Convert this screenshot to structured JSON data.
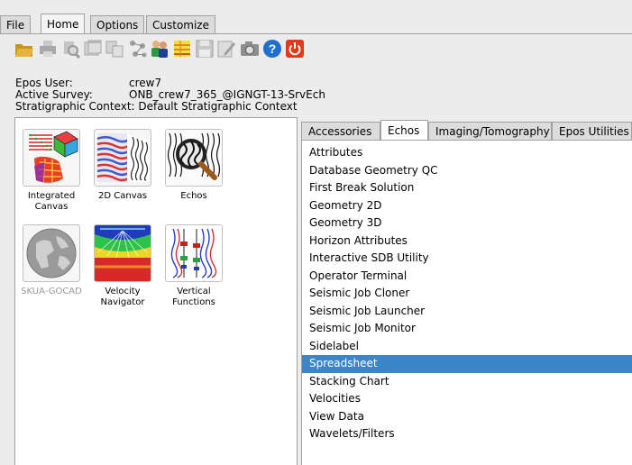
{
  "menu_tabs": [
    {
      "label": "File",
      "active": false
    },
    {
      "label": "Home",
      "active": true
    },
    {
      "label": "Options",
      "active": false
    },
    {
      "label": "Customize",
      "active": false
    }
  ],
  "toolbar_icons": [
    "open-folder-icon",
    "print-icon",
    "print-preview-icon",
    "window-icon",
    "copy-window-icon",
    "network-icon",
    "users-icon",
    "wall-icon",
    "save-icon",
    "edit-icon",
    "camera-icon",
    "help-icon",
    "power-icon"
  ],
  "info": {
    "user_label": "Epos User:",
    "user_value": "crew7",
    "survey_label": "Active Survey:",
    "survey_value": "ONB_crew7_365_@IGNGT-13-SrvEch",
    "context_label": "Stratigraphic Context:",
    "context_value": "Default Stratigraphic Context"
  },
  "apps": [
    {
      "label": "Integrated Canvas",
      "icon": "integrated-canvas-icon",
      "enabled": true
    },
    {
      "label": "2D Canvas",
      "icon": "2d-canvas-icon",
      "enabled": true
    },
    {
      "label": "Echos",
      "icon": "echos-icon",
      "enabled": true
    },
    {
      "label": "SKUA-GOCAD",
      "icon": "skua-gocad-icon",
      "enabled": false
    },
    {
      "label": "Velocity Navigator",
      "icon": "velocity-navigator-icon",
      "enabled": true
    },
    {
      "label": "Vertical Functions",
      "icon": "vertical-functions-icon",
      "enabled": true
    }
  ],
  "right_tabs": [
    {
      "label": "Accessories",
      "active": false
    },
    {
      "label": "Echos",
      "active": true
    },
    {
      "label": "Imaging/Tomography",
      "active": false
    },
    {
      "label": "Epos Utilities",
      "active": false
    }
  ],
  "echos_list": [
    {
      "label": "Attributes",
      "selected": false
    },
    {
      "label": "Database Geometry QC",
      "selected": false
    },
    {
      "label": "First Break Solution",
      "selected": false
    },
    {
      "label": "Geometry 2D",
      "selected": false
    },
    {
      "label": "Geometry 3D",
      "selected": false
    },
    {
      "label": "Horizon Attributes",
      "selected": false
    },
    {
      "label": "Interactive SDB Utility",
      "selected": false
    },
    {
      "label": "Operator Terminal",
      "selected": false
    },
    {
      "label": "Seismic Job Cloner",
      "selected": false
    },
    {
      "label": "Seismic Job Launcher",
      "selected": false
    },
    {
      "label": "Seismic Job Monitor",
      "selected": false
    },
    {
      "label": "Sidelabel",
      "selected": false
    },
    {
      "label": "Spreadsheet",
      "selected": true
    },
    {
      "label": "Stacking Chart",
      "selected": false
    },
    {
      "label": "Velocities",
      "selected": false
    },
    {
      "label": "View Data",
      "selected": false
    },
    {
      "label": "Wavelets/Filters",
      "selected": false
    }
  ],
  "colors": {
    "selection": "#3b86c9",
    "help": "#1f6fd0",
    "power": "#e03a1a"
  }
}
